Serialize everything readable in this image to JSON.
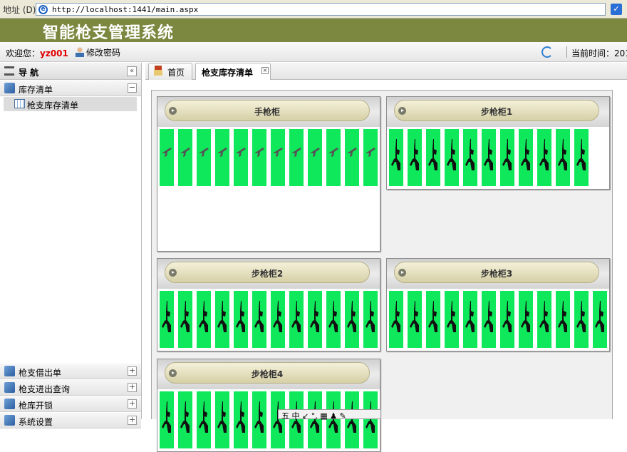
{
  "browser": {
    "address_label": "地址 (D)",
    "url": "http://localhost:1441/main.aspx"
  },
  "header": {
    "title": "智能枪支管理系统"
  },
  "userbar": {
    "welcome_label": "欢迎您：",
    "username": "yz001",
    "change_password": "修改密码",
    "time_label": "当前时间：201"
  },
  "sidebar": {
    "title": "导 航",
    "groups": [
      {
        "label": "库存清单",
        "expanded": true,
        "items": [
          {
            "label": "枪支库存清单",
            "selected": true
          }
        ]
      },
      {
        "label": "枪支借出单",
        "expanded": false
      },
      {
        "label": "枪支进出查询",
        "expanded": false
      },
      {
        "label": "枪库开锁",
        "expanded": false
      },
      {
        "label": "系统设置",
        "expanded": false
      }
    ]
  },
  "tabs": [
    {
      "label": "首页",
      "active": false
    },
    {
      "label": "枪支库存清单",
      "active": true
    }
  ],
  "cabinets": [
    {
      "name": "手枪柜",
      "type": "pistol",
      "rows": [
        12,
        0
      ],
      "row_capacity": 12
    },
    {
      "name": "步枪柜1",
      "type": "rifle",
      "rows": [
        11
      ],
      "row_capacity": 12
    },
    {
      "name": "步枪柜2",
      "type": "rifle",
      "rows": [
        12
      ],
      "row_capacity": 12
    },
    {
      "name": "步枪柜3",
      "type": "rifle",
      "rows": [
        12
      ],
      "row_capacity": 12
    },
    {
      "name": "步枪柜4",
      "type": "rifle",
      "rows": [
        12
      ],
      "row_capacity": 12
    }
  ],
  "ime": {
    "text": "五 中 ↙ °, ▦ ♟ ✎"
  },
  "colors": {
    "header": "#7c8840",
    "slot_occupied": "#0ee85a",
    "username": "#e00000"
  }
}
